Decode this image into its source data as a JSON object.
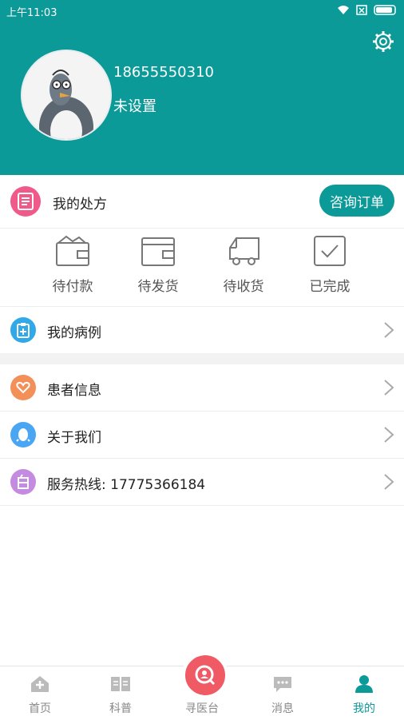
{
  "status_bar": {
    "time": "上午11:03"
  },
  "profile": {
    "phone": "18655550310",
    "nickname": "未设置"
  },
  "prescription": {
    "label": "我的处方",
    "order_button": "咨询订单"
  },
  "order_status": [
    {
      "label": "待付款",
      "icon": "wallet-icon"
    },
    {
      "label": "待发货",
      "icon": "wallet-card-icon"
    },
    {
      "label": "待收货",
      "icon": "truck-icon"
    },
    {
      "label": "已完成",
      "icon": "check-box-icon"
    }
  ],
  "menu": {
    "cases": "我的病例",
    "patient_info": "患者信息",
    "about": "关于我们",
    "hotline": "服务热线: 17775366184"
  },
  "colors": {
    "brand": "#0b9a98",
    "prescription_icon": "#f05a8b",
    "cases_icon": "#31a8e8",
    "patient_icon": "#f3905a",
    "about_icon": "#4aa6f3",
    "hotline_icon": "#c58be0",
    "center_button": "#ef5a65"
  },
  "tabbar": {
    "home": "首页",
    "science": "科普",
    "find_doctor": "寻医台",
    "messages": "消息",
    "mine": "我的"
  }
}
